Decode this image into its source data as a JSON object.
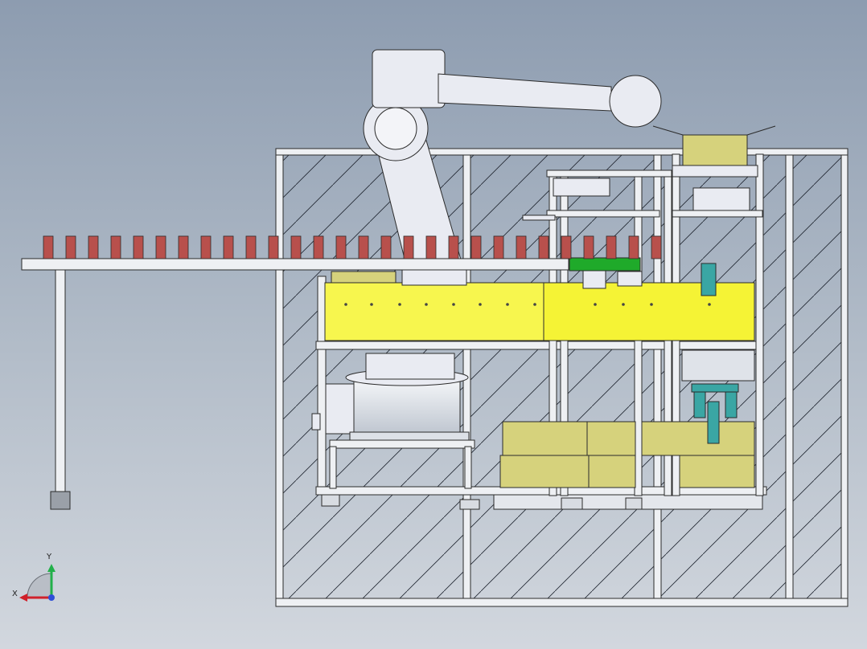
{
  "axis_triad": {
    "x_label": "X",
    "y_label": "Y"
  },
  "colors": {
    "background_top": "#8d9cb0",
    "background_bottom": "#d2d7de",
    "frame": "#e8ebef",
    "frame_edge": "#2b2b2b",
    "beam_yellow": "#f5f335",
    "box_khaki": "#d6d27c",
    "conveyor_green": "#1faa2a",
    "product_red": "#b8504c",
    "robot_body": "#e9ebf2",
    "teal_cylinder": "#3aa6a4"
  },
  "scene": {
    "conveyor_product_count": 28
  }
}
